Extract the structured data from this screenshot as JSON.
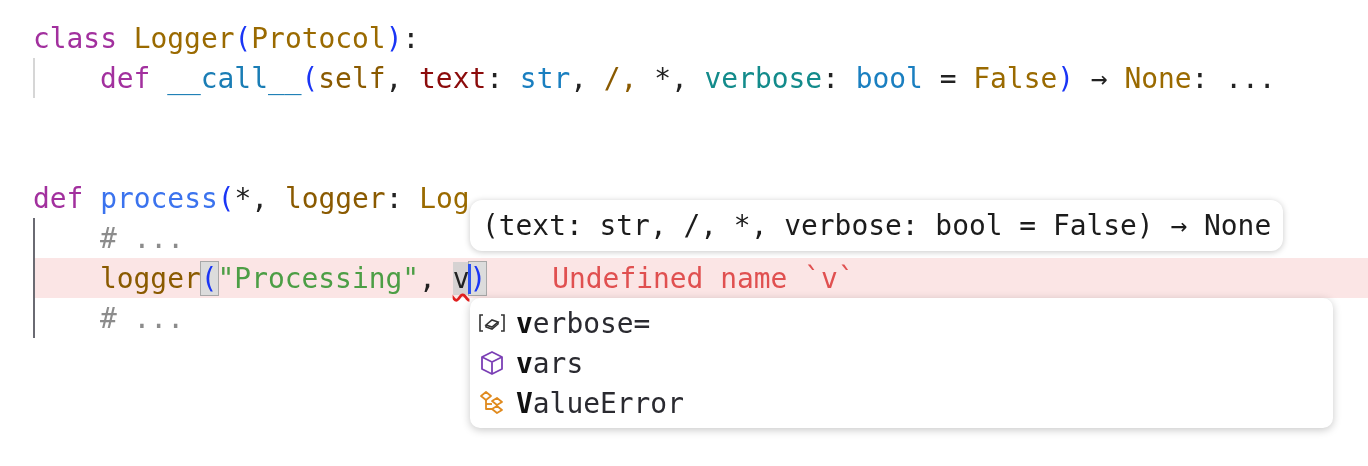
{
  "editor": {
    "blocks": [
      {
        "active": false,
        "tokens": [
          {
            "text": "class ",
            "kind": "keyword"
          },
          {
            "text": "Logger",
            "kind": "type"
          },
          {
            "text": "(",
            "kind": "paren"
          },
          {
            "text": "Protocol",
            "kind": "type"
          },
          {
            "text": ")",
            "kind": "paren"
          },
          {
            "text": ":",
            "kind": "plain"
          }
        ],
        "children": [
          {
            "tokens": [
              {
                "text": "def ",
                "kind": "keyword"
              },
              {
                "text": "__call__",
                "kind": "dunder"
              },
              {
                "text": "(",
                "kind": "paren"
              },
              {
                "text": "self",
                "kind": "self"
              },
              {
                "text": ", ",
                "kind": "plain"
              },
              {
                "text": "text",
                "kind": "param"
              },
              {
                "text": ": ",
                "kind": "plain"
              },
              {
                "text": "str",
                "kind": "builtin"
              },
              {
                "text": ", ",
                "kind": "plain"
              },
              {
                "text": "/,",
                "kind": "self"
              },
              {
                "text": " *, ",
                "kind": "plain"
              },
              {
                "text": "verbose",
                "kind": "kwparam"
              },
              {
                "text": ": ",
                "kind": "plain"
              },
              {
                "text": "bool",
                "kind": "builtin"
              },
              {
                "text": " = ",
                "kind": "plain"
              },
              {
                "text": "False",
                "kind": "type"
              },
              {
                "text": ")",
                "kind": "paren"
              },
              {
                "text": " → ",
                "kind": "plain"
              },
              {
                "text": "None",
                "kind": "type"
              },
              {
                "text": ": ...",
                "kind": "plain"
              }
            ]
          }
        ]
      },
      {
        "active": true,
        "tokens": [
          {
            "text": "def ",
            "kind": "keyword"
          },
          {
            "text": "process",
            "kind": "funcname"
          },
          {
            "text": "(",
            "kind": "paren"
          },
          {
            "text": "*, ",
            "kind": "plain"
          },
          {
            "text": "logger",
            "kind": "self"
          },
          {
            "text": ": ",
            "kind": "plain"
          },
          {
            "text": "Log",
            "kind": "type"
          }
        ],
        "children": [
          {
            "tokens": [
              {
                "text": "# ...",
                "kind": "comment"
              }
            ]
          },
          {
            "error": true,
            "message": "Undefined name `v`",
            "tokens": [
              {
                "text": "logger",
                "kind": "self"
              },
              {
                "text": "(",
                "kind": "paren",
                "matched": true
              },
              {
                "text": "\"Processing\"",
                "kind": "string"
              },
              {
                "text": ", ",
                "kind": "plain"
              },
              {
                "text": "v",
                "kind": "plain",
                "highlighted": true,
                "squiggle": true,
                "caret": true
              },
              {
                "text": ")",
                "kind": "paren",
                "matched": true
              }
            ]
          },
          {
            "tokens": [
              {
                "text": "# ...",
                "kind": "comment"
              }
            ]
          }
        ]
      }
    ]
  },
  "signature_tooltip": {
    "text": "(text: str, /, *, verbose: bool = False) → None"
  },
  "completion": {
    "items": [
      {
        "kind": "parameter",
        "label": "**v**erbose="
      },
      {
        "kind": "function",
        "label": "**v**ars"
      },
      {
        "kind": "class",
        "label": "**V**alueError"
      }
    ]
  }
}
